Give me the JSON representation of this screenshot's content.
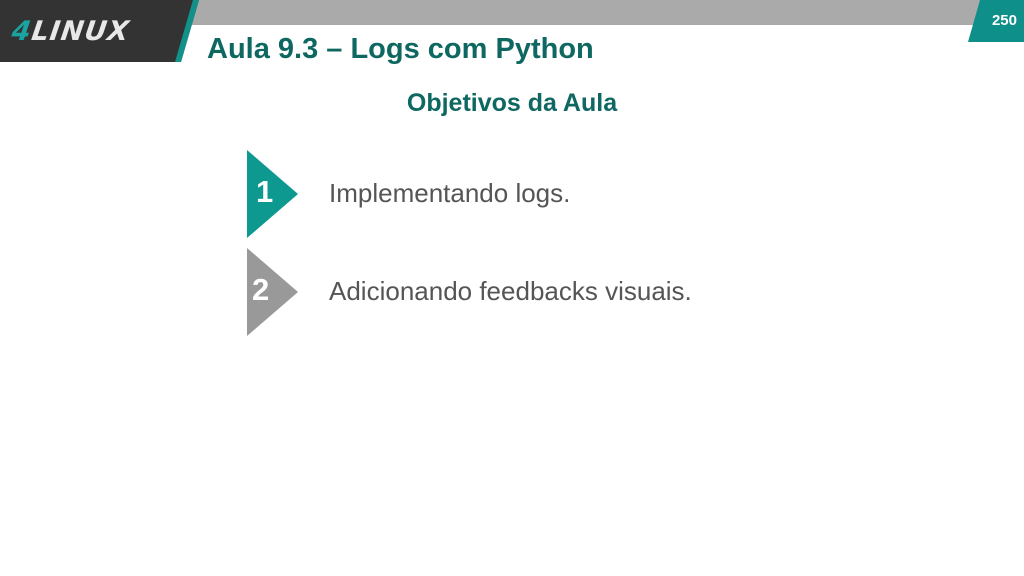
{
  "header": {
    "logo_prefix": "4",
    "logo_name": "LINUX",
    "title": "Aula 9.3 – Logs com Python",
    "page_number": "250"
  },
  "content": {
    "subtitle": "Objetivos da Aula",
    "objectives": [
      {
        "number": "1",
        "text": "Implementando logs."
      },
      {
        "number": "2",
        "text": "Adicionando feedbacks visuais."
      }
    ]
  },
  "colors": {
    "teal": "#0e9990",
    "teal_dark": "#0e6761",
    "gray": "#999999",
    "logo_bg": "#333333"
  }
}
